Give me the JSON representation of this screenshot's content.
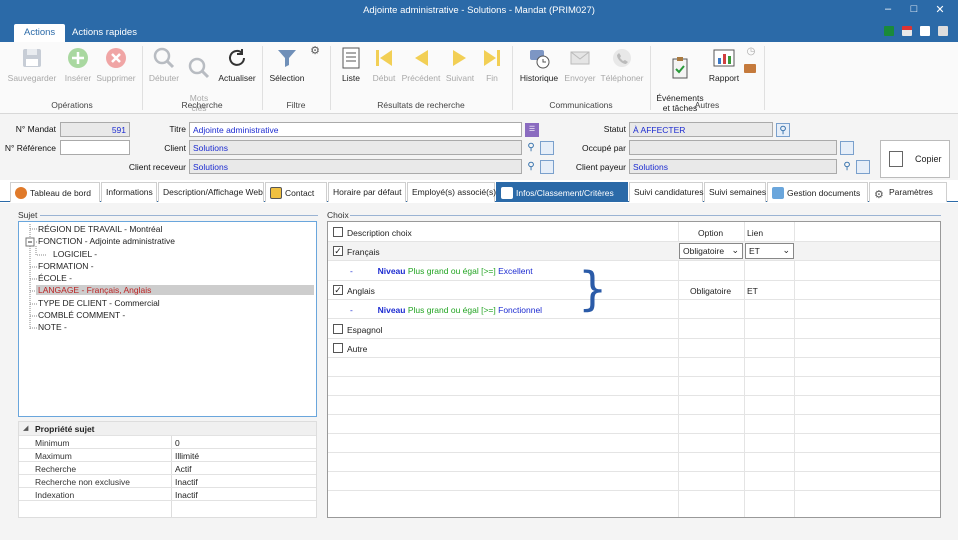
{
  "window": {
    "title": "Adjointe administrative - Solutions - Mandat (PRIM027)"
  },
  "ribbon_tabs": [
    "Actions",
    "Actions rapides"
  ],
  "ribbon": {
    "buttons": {
      "sauvegarder": "Sauvegarder",
      "inserer": "Insérer",
      "supprimer": "Supprimer",
      "debuter": "Débuter",
      "mots_cles": "Mots\nclés",
      "actualiser": "Actualiser",
      "selection": "Sélection",
      "liste": "Liste",
      "debut": "Début",
      "precedent": "Précédent",
      "suivant": "Suivant",
      "fin": "Fin",
      "historique": "Historique",
      "envoyer": "Envoyer",
      "telephoner": "Téléphoner",
      "evenements": "Événements\net tâches",
      "rapport": "Rapport"
    },
    "groups": {
      "operations": "Opérations",
      "recherche": "Recherche",
      "filtre": "Filtre",
      "resultats": "Résultats de recherche",
      "communications": "Communications",
      "autres": "Autres"
    }
  },
  "form": {
    "no_mandat_label": "N° Mandat",
    "no_mandat_value": "591",
    "no_reference_label": "N° Référence",
    "no_reference_value": "",
    "titre_label": "Titre",
    "titre_value": "Adjointe administrative",
    "client_label": "Client",
    "client_value": "Solutions",
    "client_receveur_label": "Client receveur",
    "client_receveur_value": "Solutions",
    "statut_label": "Statut",
    "statut_value": "À AFFECTER",
    "occupe_par_label": "Occupé par",
    "occupe_par_value": "",
    "client_payeur_label": "Client payeur",
    "client_payeur_value": "Solutions",
    "copier_label": "Copier"
  },
  "detail_tabs": [
    "Tableau de bord",
    "Informations",
    "Description/Affichage Web",
    "Contact",
    "Horaire par défaut",
    "Employé(s) associé(s)",
    "Infos/Classement/Critères",
    "Suivi candidatures",
    "Suivi semaines",
    "Gestion documents",
    "Paramètres"
  ],
  "sujet": {
    "title": "Sujet",
    "tree": [
      "RÉGION DE TRAVAIL - Montréal",
      "FONCTION - Adjointe administrative",
      "LOGICIEL -",
      "FORMATION -",
      "ÉCOLE -",
      "LANGAGE - Français, Anglais",
      "TYPE DE CLIENT - Commercial",
      "COMBLÉ COMMENT -",
      "NOTE -"
    ]
  },
  "proprietes": {
    "title": "Propriété sujet",
    "rows": [
      {
        "key": "Minimum",
        "value": "0"
      },
      {
        "key": "Maximum",
        "value": "Illimité"
      },
      {
        "key": "Recherche",
        "value": "Actif"
      },
      {
        "key": "Recherche non exclusive",
        "value": "Inactif"
      },
      {
        "key": "Indexation",
        "value": "Inactif"
      }
    ]
  },
  "choix": {
    "title": "Choix",
    "header": {
      "description": "Description choix",
      "option": "Option",
      "lien": "Lien"
    },
    "rows": [
      {
        "label": "Français",
        "checked": true,
        "option": "Obligatoire",
        "lien": "ET"
      },
      {
        "label": "Anglais",
        "checked": true,
        "option": "Obligatoire",
        "lien": "ET"
      },
      {
        "label": "Espagnol",
        "checked": false
      },
      {
        "label": "Autre",
        "checked": false
      }
    ],
    "niveaux": [
      {
        "dash": "-",
        "word": "Niveau",
        "op": "Plus grand ou égal [>=]",
        "value": "Excellent"
      },
      {
        "dash": "-",
        "word": "Niveau",
        "op": "Plus grand ou égal [>=]",
        "value": "Fonctionnel"
      }
    ]
  },
  "colors": {
    "accent": "#2b6aa8",
    "selection_text": "#b22222",
    "value_blue": "#1c2bd1",
    "operator_green": "#22a422"
  }
}
